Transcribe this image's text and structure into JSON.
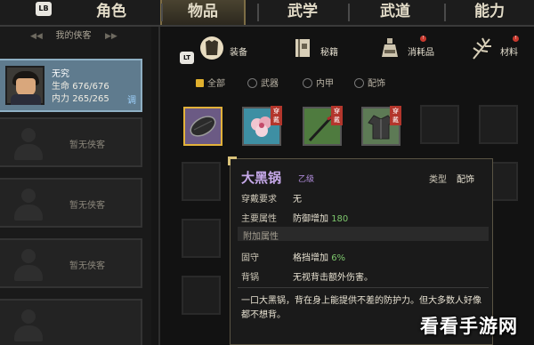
{
  "nav": {
    "lb": "LB",
    "tabs": [
      "角色",
      "物品",
      "武学",
      "武道",
      "能力"
    ],
    "active_index": 1
  },
  "party": {
    "title": "我的侠客",
    "hero": {
      "name": "无究",
      "hp_label": "生命",
      "hp": "676/676",
      "mp_label": "内力",
      "mp": "265/265",
      "adjust": "调"
    },
    "empty_label": "暂无侠客"
  },
  "categories": {
    "lt": "LT",
    "tabs": [
      {
        "label": "装备",
        "icon": "armor-icon"
      },
      {
        "label": "秘籍",
        "icon": "book-icon"
      },
      {
        "label": "消耗品",
        "icon": "potion-icon",
        "badge": "!"
      },
      {
        "label": "材料",
        "icon": "herb-icon",
        "badge": "!"
      }
    ]
  },
  "filters": [
    "全部",
    "武器",
    "内甲",
    "配饰"
  ],
  "items": [
    {
      "name": "wok",
      "badge": ""
    },
    {
      "name": "flower-robe",
      "badge": "穿戴"
    },
    {
      "name": "spear",
      "badge": "穿戴"
    },
    {
      "name": "dark-robe",
      "badge": "穿戴"
    }
  ],
  "tooltip": {
    "name": "大黑锅",
    "grade": "乙级",
    "type_label": "类型",
    "type_value": "配饰",
    "req_label": "穿戴要求",
    "req_value": "无",
    "main_label": "主要属性",
    "main_value_text": "防御增加",
    "main_value_num": "180",
    "extra_header": "附加属性",
    "extra1_label": "固守",
    "extra1_text": "格挡增加",
    "extra1_num": "6%",
    "extra2_label": "背锅",
    "extra2_value": "无视背击额外伤害。",
    "description": "一口大黑锅，背在身上能提供不差的防护力。但大多数人好像都不想背。"
  },
  "watermark": "看看手游网",
  "colors": {
    "accent_gold": "#e3b23a",
    "grade_purple": "#c6a9e9",
    "number_green": "#7ec86d",
    "badge_red": "#b3362c"
  }
}
